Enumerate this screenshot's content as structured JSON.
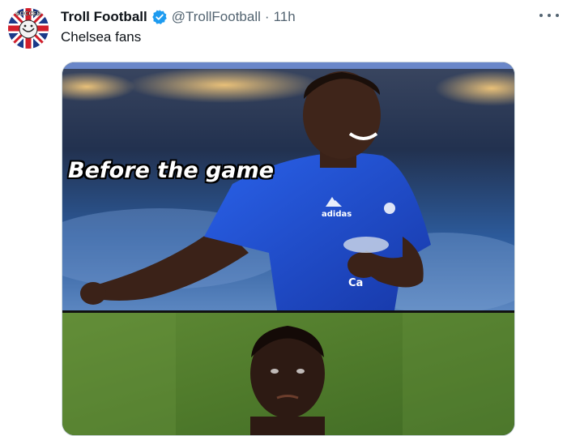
{
  "tweet": {
    "author_name": "Troll Football",
    "handle": "@TrollFootball",
    "separator": "·",
    "time": "11h",
    "text": "Chelsea fans",
    "avatar_text": "SOCCER",
    "verified": true
  },
  "media": {
    "caption_top": "Before the game",
    "shirt_brand": "adidas",
    "shirt_sponsor": "Ca"
  },
  "colors": {
    "verified_badge": "#1d9bf0",
    "secondary_text": "#536471",
    "jersey_blue": "#1f4fd8"
  },
  "icons": {
    "verified": "verified-badge-icon",
    "more": "more-options-icon"
  }
}
